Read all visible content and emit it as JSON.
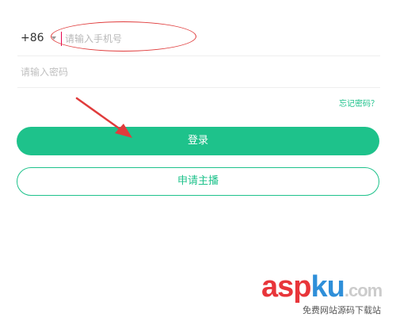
{
  "phone": {
    "country_code": "+86",
    "placeholder": "请输入手机号"
  },
  "password": {
    "placeholder": "请输入密码"
  },
  "links": {
    "forgot_password": "忘记密码？"
  },
  "buttons": {
    "login": "登录",
    "apply_anchor": "申请主播"
  },
  "watermark": {
    "part1": "asp",
    "part2": "ku",
    "part3": ".com",
    "subtitle": "免费网站源码下载站"
  },
  "colors": {
    "accent": "#1ec28b",
    "annotation": "#e03c3c",
    "watermark_red": "#e8353a",
    "watermark_blue": "#2f8fd9"
  }
}
